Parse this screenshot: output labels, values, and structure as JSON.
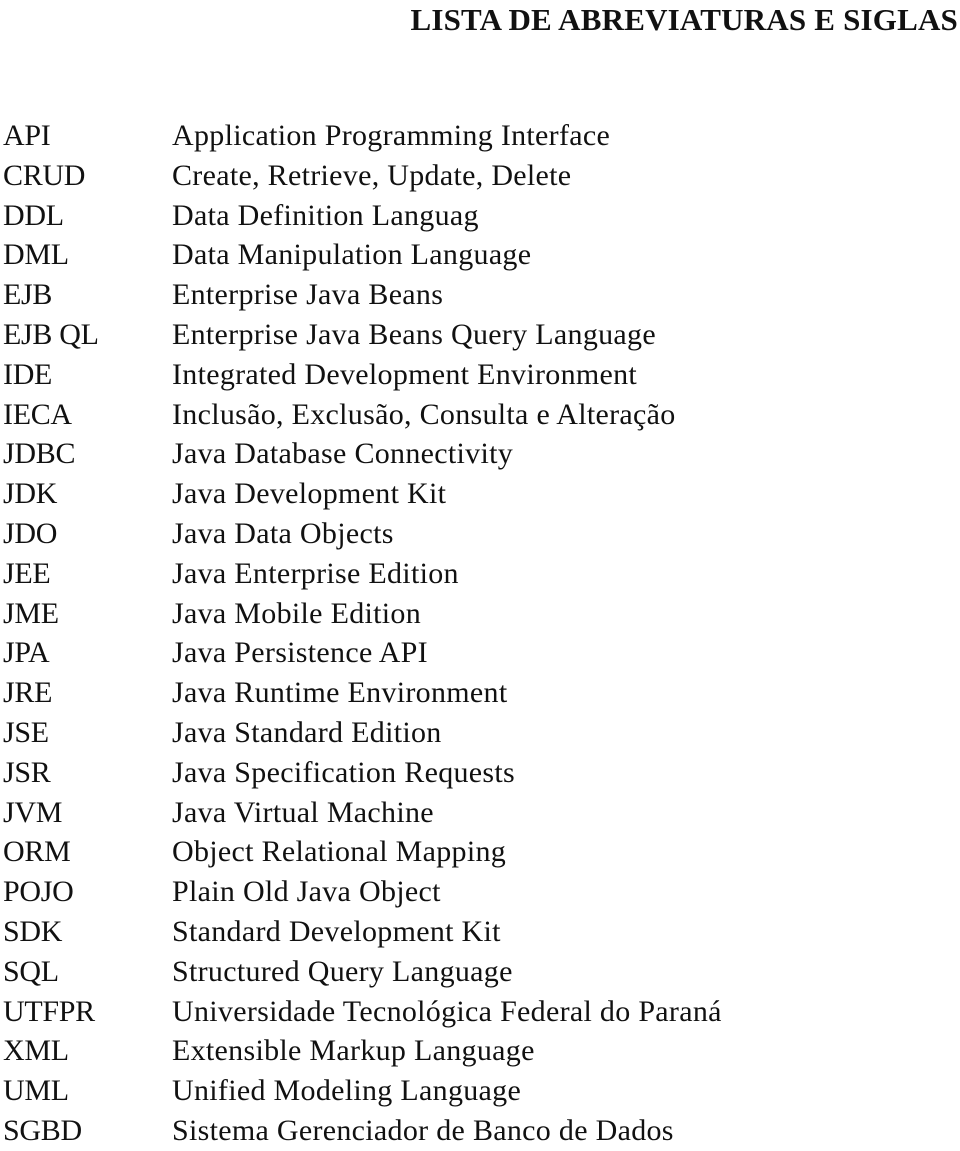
{
  "document": {
    "title": "LISTA DE ABREVIATURAS E SIGLAS",
    "entries": [
      {
        "term": "API",
        "definition": "Application Programming Interface"
      },
      {
        "term": "CRUD",
        "definition": "Create, Retrieve, Update, Delete"
      },
      {
        "term": "DDL",
        "definition": "Data Definition Languag"
      },
      {
        "term": "DML",
        "definition": "Data Manipulation Language"
      },
      {
        "term": "EJB",
        "definition": "Enterprise Java Beans"
      },
      {
        "term": "EJB QL",
        "definition": "Enterprise Java Beans Query Language"
      },
      {
        "term": "IDE",
        "definition": "Integrated Development Environment"
      },
      {
        "term": "IECA",
        "definition": "Inclusão, Exclusão, Consulta e Alteração"
      },
      {
        "term": "JDBC",
        "definition": "Java Database Connectivity"
      },
      {
        "term": "JDK",
        "definition": "Java Development Kit"
      },
      {
        "term": "JDO",
        "definition": "Java Data Objects"
      },
      {
        "term": "JEE",
        "definition": "Java Enterprise Edition"
      },
      {
        "term": "JME",
        "definition": "Java Mobile Edition"
      },
      {
        "term": "JPA",
        "definition": "Java Persistence API"
      },
      {
        "term": "JRE",
        "definition": "Java Runtime Environment"
      },
      {
        "term": "JSE",
        "definition": "Java Standard Edition"
      },
      {
        "term": "JSR",
        "definition": "Java Specification Requests"
      },
      {
        "term": "JVM",
        "definition": "Java Virtual Machine"
      },
      {
        "term": "ORM",
        "definition": "Object Relational Mapping"
      },
      {
        "term": "POJO",
        "definition": "Plain Old Java Object"
      },
      {
        "term": "SDK",
        "definition": "Standard Development Kit"
      },
      {
        "term": "SQL",
        "definition": "Structured Query Language"
      },
      {
        "term": "UTFPR",
        "definition": "Universidade Tecnológica Federal do Paraná"
      },
      {
        "term": "XML",
        "definition": "Extensible Markup Language"
      },
      {
        "term": "UML",
        "definition": "Unified Modeling Language"
      },
      {
        "term": "SGBD",
        "definition": "Sistema Gerenciador de Banco de Dados"
      }
    ]
  }
}
